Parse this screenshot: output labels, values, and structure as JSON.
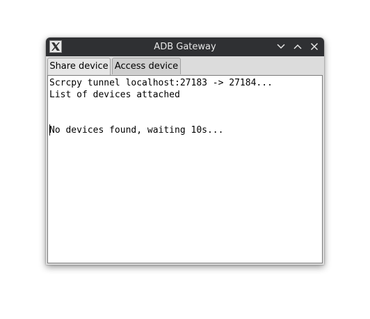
{
  "window": {
    "title": "ADB Gateway",
    "icon": "x11-icon",
    "controls": [
      "chevron-down-icon",
      "chevron-up-icon",
      "close-icon"
    ]
  },
  "tabs": [
    {
      "label": "Share device",
      "selected": true
    },
    {
      "label": "Access device",
      "selected": false
    }
  ],
  "log": {
    "lines": [
      "Scrcpy tunnel localhost:27183 -> 27184...",
      "List of devices attached",
      "",
      "",
      "No devices found, waiting 10s..."
    ]
  },
  "colors": {
    "titlebar": "#2f3033",
    "window_bg": "#dcdcdc",
    "content_bg": "#ffffff"
  }
}
